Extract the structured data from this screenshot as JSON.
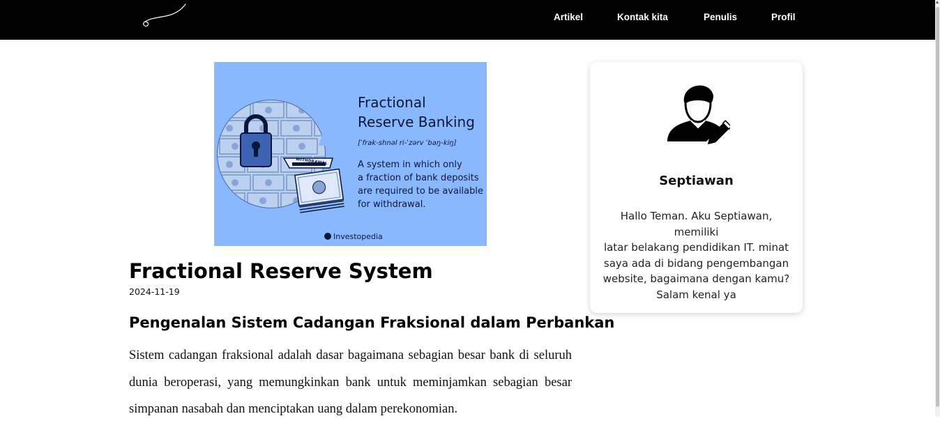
{
  "nav": {
    "items": [
      {
        "label": "Artikel"
      },
      {
        "label": "Kontak kita"
      },
      {
        "label": "Penulis"
      },
      {
        "label": "Profil"
      }
    ]
  },
  "hero_image": {
    "title": "Fractional\nReserve Banking",
    "phonetic": "[ˈfrak-shnəl ri-ˈzərv ˈbaŋ-kiŋ]",
    "definition": "A system in which only\na fraction of bank deposits\nare required to be available\nfor withdrawal.",
    "slot_label": "WITHDRAWAL",
    "brand": "Investopedia",
    "background_color": "#8ab8ff"
  },
  "article": {
    "title": "Fractional Reserve System",
    "date": "2024-11-19",
    "subtitle": "Pengenalan Sistem Cadangan Fraksional dalam Perbankan",
    "body": "Sistem cadangan fraksional adalah dasar bagaimana sebagian besar bank di seluruh dunia beroperasi, yang memungkinkan bank untuk meminjamkan sebagian besar simpanan nasabah dan menciptakan uang dalam perekonomian."
  },
  "author": {
    "icon": "user-edit-icon",
    "name": "Septiawan",
    "bio": "Hallo Teman. Aku Septiawan, memiliki\nlatar belakang pendidikan IT. minat\nsaya ada di bidang pengembangan\nwebsite, bagaimana dengan kamu?\nSalam kenal ya"
  },
  "colors": {
    "navbar": "#000000",
    "nav_text": "#ffffff",
    "hero_text": "#0b1738"
  }
}
